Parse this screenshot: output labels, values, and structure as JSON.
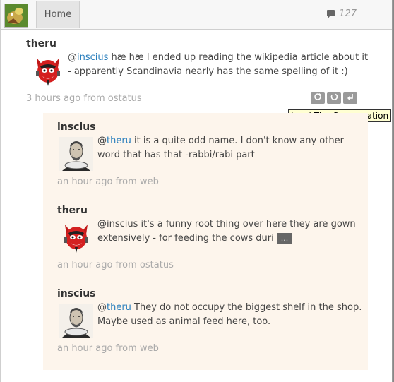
{
  "header": {
    "home_label": "Home",
    "count": "127"
  },
  "posts": [
    {
      "author": "theru",
      "mention": "inscius",
      "text_after": " hæ hæ I ended up reading the wikipedia article about it - apparently Scandinavia nearly has the same spelling of it :)",
      "meta": "3 hours ago from ostatus"
    }
  ],
  "tooltip": "Load The Conversation",
  "conversation": [
    {
      "author": "inscius",
      "mention": "theru",
      "text_after": " it is a quite odd name. I don't know any other word that has that -rabbi/rabi part",
      "meta": "an hour ago from web"
    },
    {
      "author": "theru",
      "text": "@inscius it's a funny root thing over here they are gown extensively - for feeding the cows duri",
      "more": "...",
      "meta": "an hour ago from ostatus"
    },
    {
      "author": "inscius",
      "mention": "theru",
      "text_after": " They do not occupy the biggest shelf in the shop. Maybe used as animal feed here, too.",
      "meta": "an hour ago from web"
    }
  ],
  "icons": {
    "reply": "reply-icon",
    "repeat": "repeat-icon",
    "conversation": "expand-conversation-icon",
    "comment": "comment-bubble-icon"
  }
}
